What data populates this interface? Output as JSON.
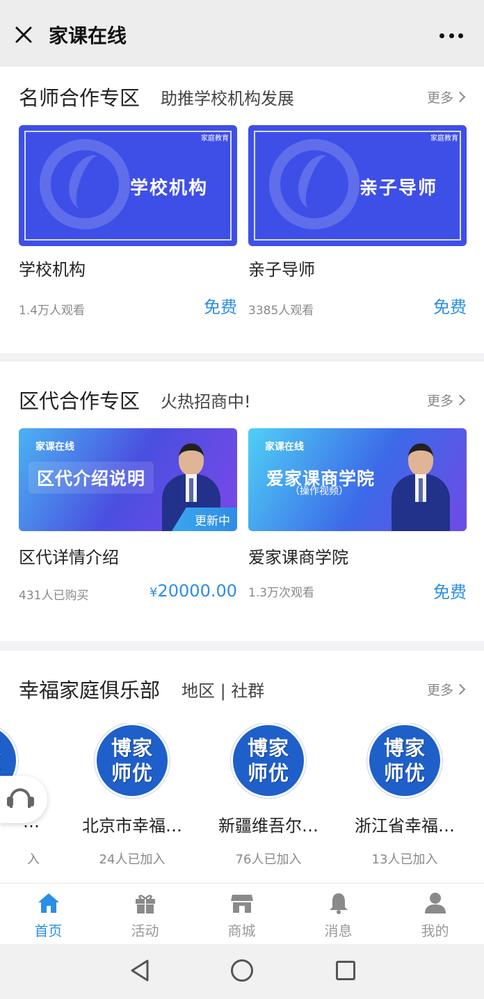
{
  "topbar": {
    "title": "家课在线",
    "close_icon": "close-icon",
    "more_icon": "more-dots-icon"
  },
  "section1": {
    "title": "名师合作专区",
    "subtitle": "助推学校机构发展",
    "more": "更多",
    "cards": [
      {
        "brand": "家庭教育",
        "banner": "学校机构",
        "title": "学校机构",
        "meta": "1.4万人观看",
        "price": "免费"
      },
      {
        "brand": "家庭教育",
        "banner": "亲子导师",
        "title": "亲子导师",
        "meta": "3385人观看",
        "price": "免费"
      }
    ]
  },
  "section2": {
    "title": "区代合作专区",
    "subtitle": "火热招商中!",
    "more": "更多",
    "cards": [
      {
        "logo": "家课在线",
        "banner": "区代介绍说明",
        "badge": "更新中",
        "title": "区代详情介绍",
        "meta": "431人已购买",
        "currency": "¥",
        "price": "20000.00"
      },
      {
        "logo": "家课在线",
        "banner": "爱家课商学院",
        "banner_sub": "（操作视频）",
        "title": "爱家课商学院",
        "meta": "1.3万次观看",
        "price": "免费"
      }
    ]
  },
  "section3": {
    "title": "幸福家庭俱乐部",
    "subtitle": "地区 | 社群",
    "more": "更多",
    "avatar_line1": "博家",
    "avatar_line2": "师优",
    "clubs": [
      {
        "name": "…",
        "count": "入"
      },
      {
        "name": "北京市幸福…",
        "count": "24人已加入"
      },
      {
        "name": "新疆维吾尔…",
        "count": "76人已加入"
      },
      {
        "name": "浙江省幸福…",
        "count": "13人已加入"
      }
    ]
  },
  "tabbar": {
    "tabs": [
      {
        "label": "首页",
        "icon": "home-icon",
        "active": true
      },
      {
        "label": "活动",
        "icon": "gift-icon",
        "active": false
      },
      {
        "label": "商城",
        "icon": "shop-icon",
        "active": false
      },
      {
        "label": "消息",
        "icon": "bell-icon",
        "active": false
      },
      {
        "label": "我的",
        "icon": "user-icon",
        "active": false
      }
    ]
  },
  "colors": {
    "accent": "#2a8ee6",
    "banner_blue": "#3e4fe8",
    "club_blue": "#1f5fc9"
  }
}
